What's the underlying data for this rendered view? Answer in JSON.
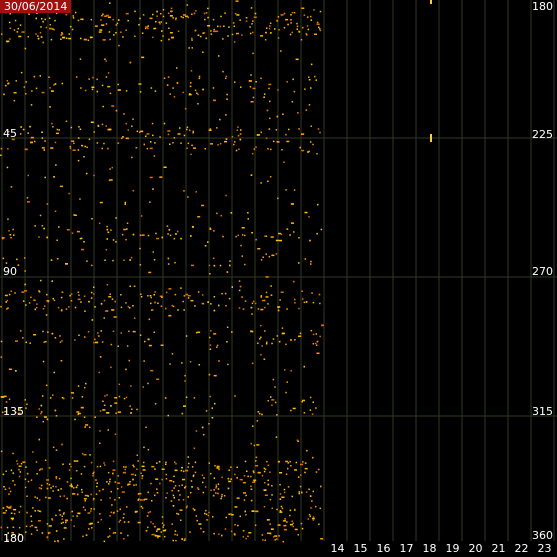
{
  "header": {
    "date": "30/06/2014"
  },
  "left_axis_labels": [
    "45",
    "90",
    "135",
    "180"
  ],
  "right_axis_labels": [
    "180",
    "225",
    "270",
    "315",
    "360"
  ],
  "hour_labels": [
    "14",
    "15",
    "16",
    "17",
    "18",
    "19",
    "20",
    "21",
    "22",
    "23"
  ],
  "colors": {
    "background": "#000000",
    "grid": "#2e3a1f",
    "dots": "#ff9900",
    "dots_bright": "#ffc800",
    "date_bg": "#a01010"
  },
  "icons": [
    "marker-icon"
  ]
}
